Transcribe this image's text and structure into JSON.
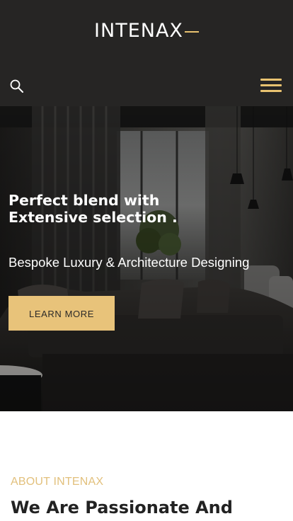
{
  "header": {
    "logo_text": "INTENAX",
    "search_icon": "search-icon",
    "menu_icon": "hamburger-menu-icon",
    "accent_color": "#e8c270",
    "background_color": "#262524"
  },
  "hero": {
    "title_line1": "Perfect blend with",
    "title_line2": "Extensive selection .",
    "subtitle": "Bespoke Luxury & Architecture Designing",
    "button_label": "LEARN MORE",
    "button_color": "#e8c37a"
  },
  "about": {
    "label": "ABOUT INTENAX",
    "title": "We Are Passionate And"
  }
}
